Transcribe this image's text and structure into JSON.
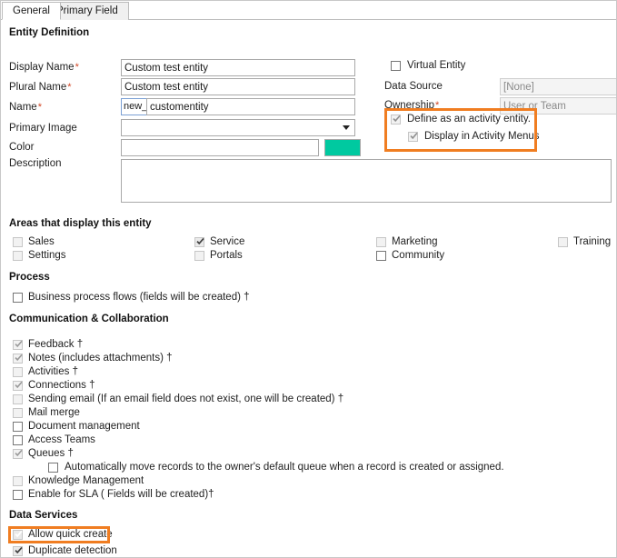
{
  "tabs": [
    {
      "label": "General",
      "active": true
    },
    {
      "label": "Primary Field",
      "active": false
    }
  ],
  "sections": {
    "entity_definition": "Entity Definition",
    "areas": "Areas that display this entity",
    "process": "Process",
    "communication": "Communication & Collaboration",
    "data_services": "Data Services"
  },
  "fields": {
    "display_name": {
      "label": "Display Name",
      "required": "*",
      "value": "Custom test entity"
    },
    "plural_name": {
      "label": "Plural Name",
      "required": "*",
      "value": "Custom test entity"
    },
    "name": {
      "label": "Name",
      "required": "*",
      "prefix": "new_",
      "value": "customentity"
    },
    "primary_image": {
      "label": "Primary Image",
      "value": ""
    },
    "color": {
      "label": "Color",
      "value": "",
      "swatch_hex": "#00c9a0"
    },
    "description": {
      "label": "Description",
      "value": ""
    },
    "virtual_entity": {
      "label": "Virtual Entity",
      "checked": false
    },
    "data_source": {
      "label": "Data Source",
      "value": "[None]"
    },
    "ownership": {
      "label": "Ownership",
      "required": "*",
      "value": "User or Team"
    },
    "define_activity": {
      "label": "Define as an activity entity.",
      "checked": true
    },
    "display_activity_menus": {
      "label": "Display in Activity Menus",
      "checked": true
    }
  },
  "areas_checkboxes": [
    {
      "label": "Sales",
      "checked": false,
      "disabled": true
    },
    {
      "label": "Settings",
      "checked": false,
      "disabled": true
    },
    {
      "label": "Service",
      "checked": true,
      "disabled": false
    },
    {
      "label": "Portals",
      "checked": false,
      "disabled": true
    },
    {
      "label": "Marketing",
      "checked": false,
      "disabled": false
    },
    {
      "label": "Community",
      "checked": false,
      "disabled": false
    },
    {
      "label": "Training",
      "checked": false,
      "disabled": true
    }
  ],
  "process_checkboxes": [
    {
      "label": "Business process flows (fields will be created) †",
      "checked": false,
      "disabled": false
    }
  ],
  "communication_checkboxes": [
    {
      "label": "Feedback †",
      "checked": true,
      "disabled": true
    },
    {
      "label": "Notes (includes attachments) †",
      "checked": true,
      "disabled": true
    },
    {
      "label": "Activities †",
      "checked": false,
      "disabled": true
    },
    {
      "label": "Connections †",
      "checked": true,
      "disabled": true
    },
    {
      "label": "Sending email (If an email field does not exist, one will be created) †",
      "checked": false,
      "disabled": true
    },
    {
      "label": "Mail merge",
      "checked": false,
      "disabled": true
    },
    {
      "label": "Document management",
      "checked": false,
      "disabled": false
    },
    {
      "label": "Access Teams",
      "checked": false,
      "disabled": false
    },
    {
      "label": "Queues †",
      "checked": true,
      "disabled": true
    },
    {
      "label": "Automatically move records to the owner's default queue when a record is created or assigned.",
      "checked": false,
      "disabled": false
    },
    {
      "label": "Knowledge Management",
      "checked": false,
      "disabled": true
    },
    {
      "label": "Enable for SLA ( Fields will be created)†",
      "checked": false,
      "disabled": false
    }
  ],
  "data_services_checkboxes": [
    {
      "label": "Allow quick create",
      "checked": true,
      "disabled": true
    },
    {
      "label": "Duplicate detection",
      "checked": true,
      "disabled": true
    }
  ],
  "highlights": {
    "accent_hex": "#f07d21",
    "activity_entity_box": "Define as an activity entity / Display in Activity Menus",
    "allow_quick_create_box": "Allow quick create"
  }
}
